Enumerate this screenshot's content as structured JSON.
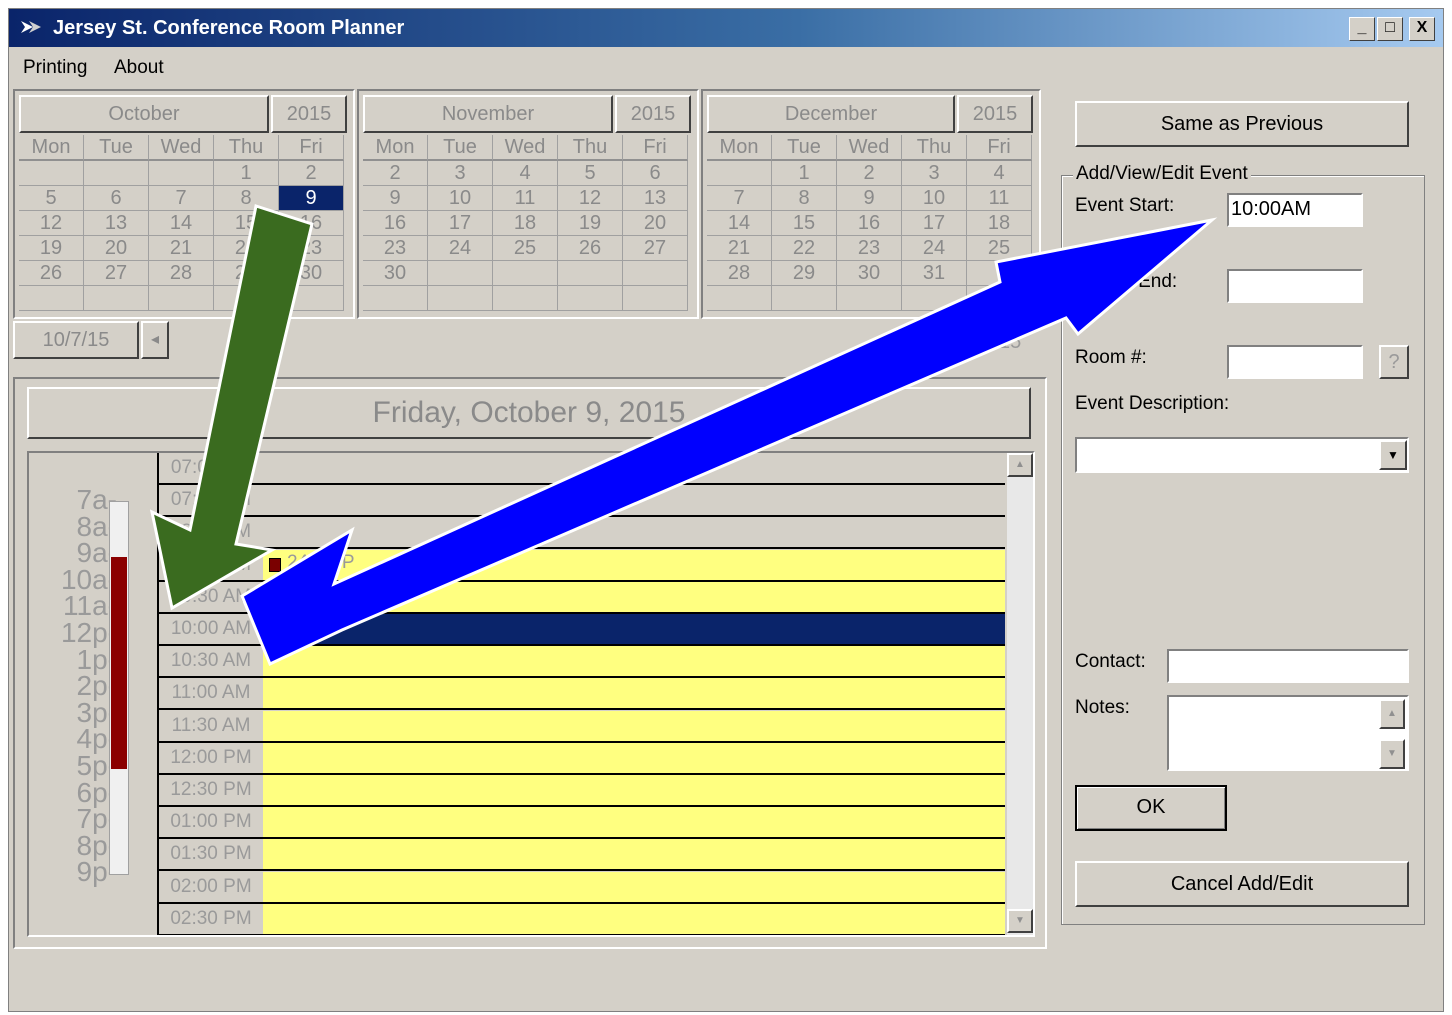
{
  "window": {
    "title": "Jersey St. Conference Room Planner",
    "controls": [
      "_",
      "□",
      "X"
    ]
  },
  "menu": [
    "Printing",
    "About"
  ],
  "calendars": [
    {
      "month": "October",
      "year": "2015",
      "days": [
        "Mon",
        "Tue",
        "Wed",
        "Thu",
        "Fri"
      ],
      "weeks": [
        [
          "",
          "",
          "",
          "1",
          "2"
        ],
        [
          "5",
          "6",
          "7",
          "8",
          "9"
        ],
        [
          "12",
          "13",
          "14",
          "15",
          "16"
        ],
        [
          "19",
          "20",
          "21",
          "22",
          "23"
        ],
        [
          "26",
          "27",
          "28",
          "29",
          "30"
        ],
        [
          "",
          "",
          "",
          "",
          ""
        ]
      ],
      "selected": "9"
    },
    {
      "month": "November",
      "year": "2015",
      "days": [
        "Mon",
        "Tue",
        "Wed",
        "Thu",
        "Fri"
      ],
      "weeks": [
        [
          "2",
          "3",
          "4",
          "5",
          "6"
        ],
        [
          "9",
          "10",
          "11",
          "12",
          "13"
        ],
        [
          "16",
          "17",
          "18",
          "19",
          "20"
        ],
        [
          "23",
          "24",
          "25",
          "26",
          "27"
        ],
        [
          "30",
          "",
          "",
          "",
          ""
        ],
        [
          "",
          "",
          "",
          "",
          ""
        ]
      ],
      "selected": ""
    },
    {
      "month": "December",
      "year": "2015",
      "days": [
        "Mon",
        "Tue",
        "Wed",
        "Thu",
        "Fri"
      ],
      "weeks": [
        [
          "",
          "1",
          "2",
          "3",
          "4"
        ],
        [
          "7",
          "8",
          "9",
          "10",
          "11"
        ],
        [
          "14",
          "15",
          "16",
          "17",
          "18"
        ],
        [
          "21",
          "22",
          "23",
          "24",
          "25"
        ],
        [
          "28",
          "29",
          "30",
          "31",
          ""
        ],
        [
          "",
          "",
          "",
          "",
          ""
        ]
      ],
      "selected": ""
    }
  ],
  "nav": {
    "date": "10/7/15",
    "prev": "◂",
    "end_fragment": "15"
  },
  "day_view": {
    "header": "Friday, October 9, 2015",
    "hour_labels": [
      "7a-",
      "8a-",
      "9a-",
      "10a-",
      "11a-",
      "12p-",
      "1p-",
      "2p-",
      "3p-",
      "4p-",
      "5p-",
      "6p-",
      "7p-",
      "8p-",
      "9p-"
    ],
    "slots": [
      {
        "time": "07:00 AM",
        "state": "empty"
      },
      {
        "time": "07:30 AM",
        "state": "empty"
      },
      {
        "time": "08:00 AM",
        "state": "empty"
      },
      {
        "time": "08:30 AM",
        "state": "booked",
        "event": "249:ISP"
      },
      {
        "time": "09:30 AM",
        "state": "booked"
      },
      {
        "time": "10:00 AM",
        "state": "selected"
      },
      {
        "time": "10:30 AM",
        "state": "booked"
      },
      {
        "time": "11:00 AM",
        "state": "booked"
      },
      {
        "time": "11:30 AM",
        "state": "booked"
      },
      {
        "time": "12:00 PM",
        "state": "booked"
      },
      {
        "time": "12:30 PM",
        "state": "booked"
      },
      {
        "time": "01:00 PM",
        "state": "booked"
      },
      {
        "time": "01:30 PM",
        "state": "booked"
      },
      {
        "time": "02:00 PM",
        "state": "booked"
      },
      {
        "time": "02:30 PM",
        "state": "booked"
      }
    ]
  },
  "right_panel": {
    "same_as_previous": "Same as Previous",
    "group_title": "Add/View/Edit Event",
    "event_start_label": "Event Start:",
    "event_start_value": "10:00AM",
    "event_end_label": "nt End:",
    "event_end_value": "",
    "room_label": "Room #:",
    "room_value": "",
    "room_help": "?",
    "description_label": "Event Description:",
    "description_value": "",
    "contact_label": "Contact:",
    "contact_value": "",
    "notes_label": "Notes:",
    "notes_value": "",
    "ok": "OK",
    "cancel": "Cancel Add/Edit"
  },
  "colors": {
    "title_gradient_start": "#0a246a",
    "booked": "#ffff80",
    "selected": "#0a246a",
    "usage_bar": "#8b0000",
    "green_arrow": "#3a6b1f",
    "blue_arrow": "#0000ff"
  },
  "icons": [
    "app-icon",
    "minimize-icon",
    "maximize-icon",
    "close-icon",
    "dropdown-arrow-icon",
    "scroll-up-icon",
    "scroll-down-icon",
    "help-icon"
  ]
}
